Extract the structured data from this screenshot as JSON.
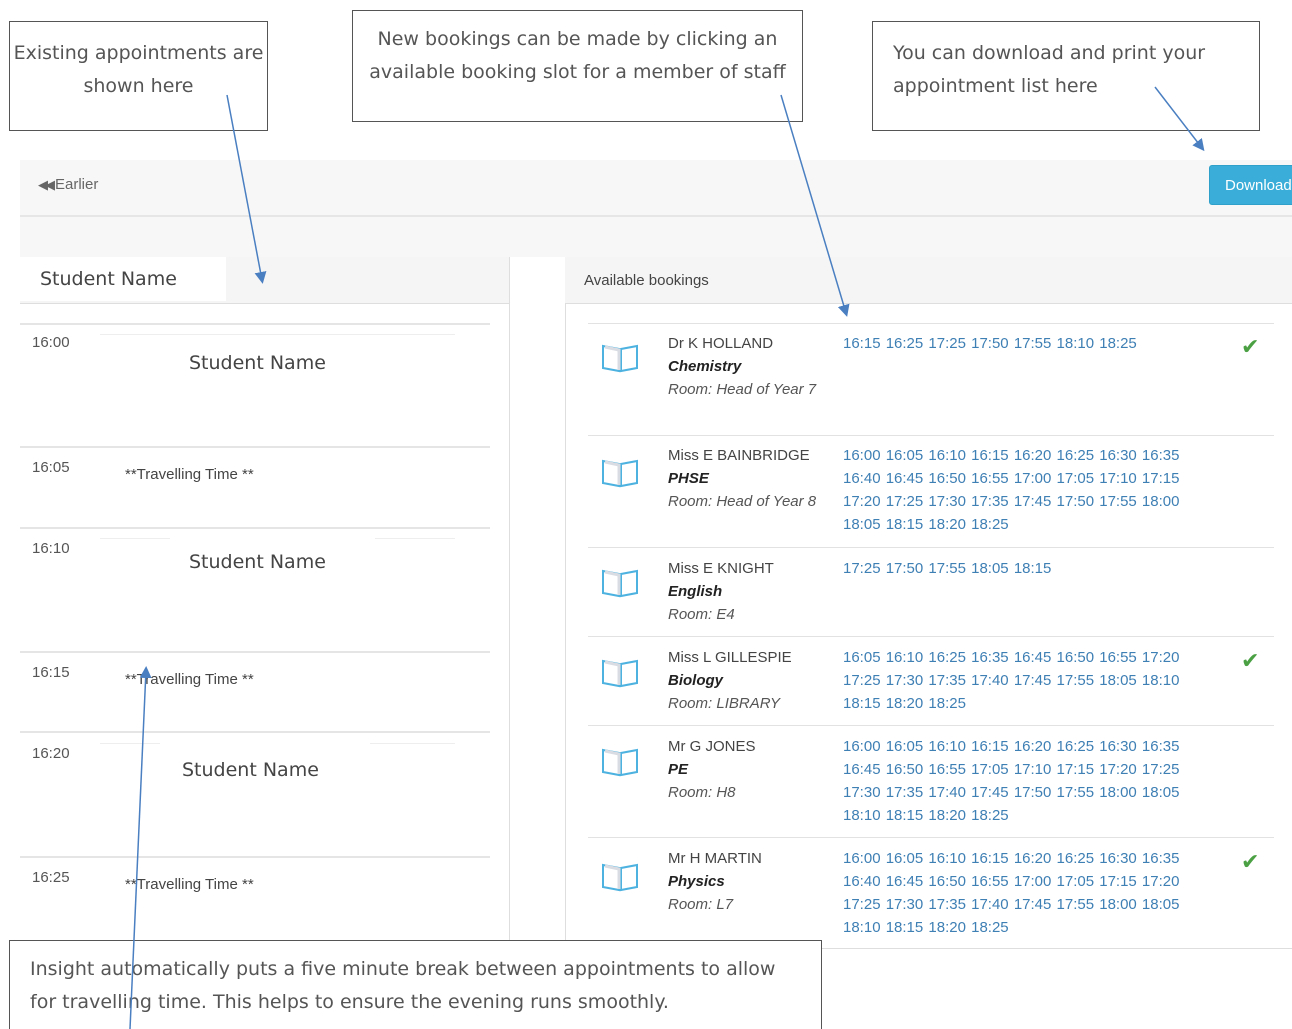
{
  "callouts": {
    "existing": "Existing appointments are shown here",
    "new_bookings": "New bookings can be made by clicking an available booking slot for a member of staff",
    "download": "You can download and print your appointment list here",
    "insight": "Insight automatically puts a five minute break between appointments to allow for travelling time. This helps to ensure the evening runs smoothly."
  },
  "toolbar": {
    "earlier_label": "Earlier",
    "download_label": "Download"
  },
  "left_panel": {
    "header": "Student Name",
    "slots": [
      {
        "time": "16:00",
        "text": "Student Name",
        "kind": "student"
      },
      {
        "time": "16:05",
        "text": "**Travelling Time **",
        "kind": "travel"
      },
      {
        "time": "16:10",
        "text": "Student Name",
        "kind": "student"
      },
      {
        "time": "16:15",
        "text": "**Travelling Time **",
        "kind": "travel"
      },
      {
        "time": "16:20",
        "text": "Student Name",
        "kind": "student"
      },
      {
        "time": "16:25",
        "text": "**Travelling Time **",
        "kind": "travel"
      }
    ]
  },
  "right_panel": {
    "title": "Available bookings",
    "teachers": [
      {
        "name": "Dr K HOLLAND",
        "subject": "Chemistry",
        "room": "Room: Head of Year 7",
        "times": "16:15 16:25 17:25 17:50 17:55 18:10 18:25",
        "booked": true
      },
      {
        "name": "Miss E BAINBRIDGE",
        "subject": "PHSE",
        "room": "Room: Head of Year 8",
        "times": "16:00 16:05 16:10 16:15 16:20 16:25 16:30 16:35 16:40 16:45 16:50 16:55 17:00 17:05 17:10 17:15 17:20 17:25 17:30 17:35 17:45 17:50 17:55 18:00 18:05 18:15 18:20 18:25",
        "booked": false
      },
      {
        "name": "Miss E KNIGHT",
        "subject": "English",
        "room": "Room: E4",
        "times": "17:25 17:50 17:55 18:05 18:15",
        "booked": false
      },
      {
        "name": "Miss L GILLESPIE",
        "subject": "Biology",
        "room": "Room: LIBRARY",
        "times": "16:05 16:10 16:25 16:35 16:45 16:50 16:55 17:20 17:25 17:30 17:35 17:40 17:45 17:55 18:05 18:10 18:15 18:20 18:25",
        "booked": true
      },
      {
        "name": "Mr G JONES",
        "subject": "PE",
        "room": "Room: H8",
        "times": "16:00 16:05 16:10 16:15 16:20 16:25 16:30 16:35 16:45 16:50 16:55 17:05 17:10 17:15 17:20 17:25 17:30 17:35 17:40 17:45 17:50 17:55 18:00 18:05 18:10 18:15 18:20 18:25",
        "booked": false
      },
      {
        "name": "Mr H MARTIN",
        "subject": "Physics",
        "room": "Room: L7",
        "times": "16:00 16:05 16:10 16:15 16:20 16:25 16:30 16:35 16:40 16:45 16:50 16:55 17:00 17:05 17:15 17:20 17:25 17:30 17:35 17:40 17:45 17:55 18:00 18:05 18:10 18:15 18:20 18:25",
        "booked": true
      }
    ]
  },
  "colors": {
    "accent": "#3aaed8",
    "link": "#3e7fb4",
    "check": "#4aa043",
    "arrow": "#4a7fc1"
  }
}
